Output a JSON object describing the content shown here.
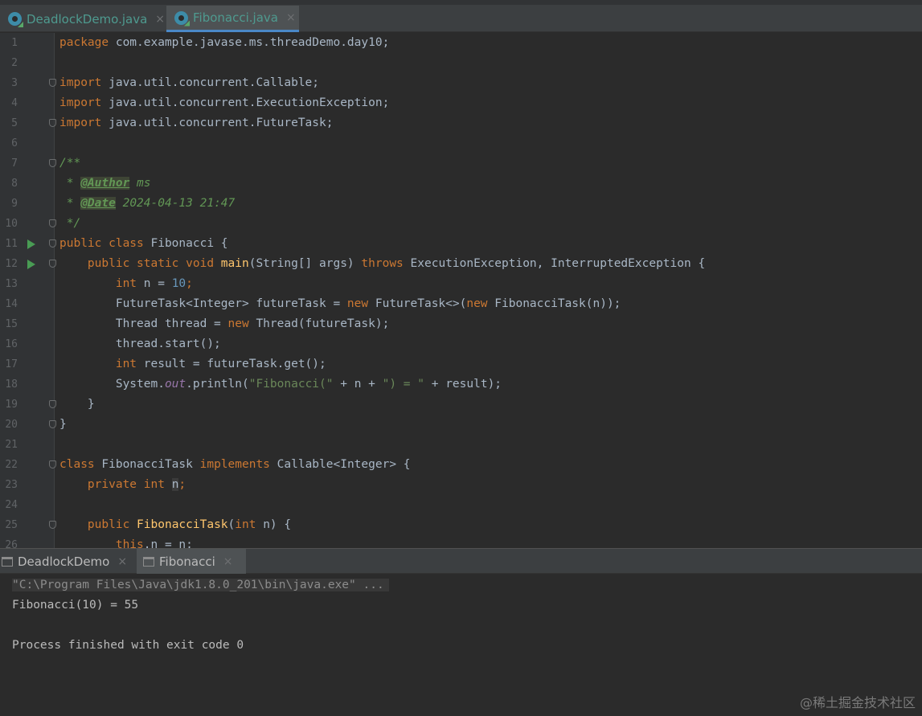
{
  "editor_tabs": [
    {
      "label": "DeadlockDemo.java",
      "close": "×"
    },
    {
      "label": "Fibonacci.java",
      "close": "×"
    }
  ],
  "code": {
    "l1": {
      "a": "package",
      "b": " com.example.javase.ms.threadDemo.day10;"
    },
    "l3": {
      "a": "import",
      "b": " java.util.concurrent.Callable;"
    },
    "l4": {
      "a": "import",
      "b": " java.util.concurrent.ExecutionException;"
    },
    "l5": {
      "a": "import",
      "b": " java.util.concurrent.FutureTask;"
    },
    "l7": "/**",
    "l8": {
      "a": " * ",
      "tag": "@Author",
      "b": " ms"
    },
    "l9": {
      "a": " * ",
      "tag": "@Date",
      "b": " 2024-04-13 21:47"
    },
    "l10": " */",
    "l11": {
      "a": "public class",
      "b": " Fibonacci {"
    },
    "l12": {
      "a": "    public static void",
      "fn": " main",
      "b": "(String[] args) ",
      "kw2": "throws",
      "c": " ExecutionException, InterruptedException {"
    },
    "l13": {
      "a": "        int",
      "b": " n = ",
      "num": "10",
      "c": ";"
    },
    "l14": {
      "a": "        FutureTask<Integer> futureTask = ",
      "kw": "new",
      "b": " FutureTask<>(",
      "kw2": "new",
      "c": " FibonacciTask(n));"
    },
    "l15": {
      "a": "        Thread thread = ",
      "kw": "new",
      "b": " Thread(futureTask);"
    },
    "l16": "        thread.start();",
    "l17": {
      "a": "        int",
      "b": " result = futureTask.get();"
    },
    "l18": {
      "a": "        System.",
      "st": "out",
      "b": ".println(",
      "str1": "\"Fibonacci(\"",
      "c": " + n + ",
      "str2": "\") = \"",
      "d": " + result);"
    },
    "l19": "    }",
    "l20": "}",
    "l22": {
      "a": "class",
      "b": " FibonacciTask ",
      "kw2": "implements",
      "c": " Callable<Integer> {"
    },
    "l23": {
      "a": "    private int",
      "b": " ",
      "hl": "n",
      "c": ";"
    },
    "l25": {
      "a": "    public",
      "fn": " FibonacciTask",
      "b": "(",
      "kw2": "int",
      "c": " n) {"
    },
    "l26": {
      "a": "        this",
      "b": ".n = n;"
    }
  },
  "console_tabs": [
    {
      "label": "DeadlockDemo",
      "close": "×"
    },
    {
      "label": "Fibonacci",
      "close": "×"
    }
  ],
  "console": {
    "cmd": "\"C:\\Program Files\\Java\\jdk1.8.0_201\\bin\\java.exe\" ...",
    "output": "Fibonacci(10) = 55",
    "finished": "Process finished with exit code 0"
  },
  "watermark": "@稀土掘金技术社区"
}
